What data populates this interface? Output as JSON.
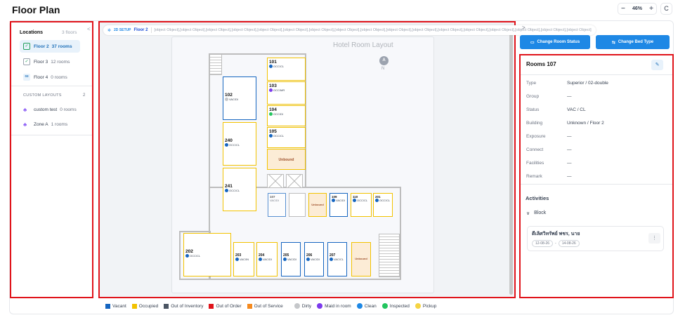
{
  "header": {
    "title": "Floor Plan",
    "zoom": "46%",
    "zoom_minus": "−",
    "zoom_plus": "+",
    "refresh": "C"
  },
  "left": {
    "locations_label": "Locations",
    "locations_count": "3 floors",
    "collapse": "<",
    "floors": [
      {
        "name": "Floor 2",
        "count": "37 rooms",
        "active": true
      },
      {
        "name": "Floor 3",
        "count": "12 rooms"
      },
      {
        "name": "Floor 4",
        "count": "0 rooms",
        "badge": "03"
      }
    ],
    "custom_label": "CUSTOM LAYOUTS",
    "custom_count": "2",
    "customs": [
      {
        "name": "custom test",
        "count": "0 rooms"
      },
      {
        "name": "Zone A",
        "count": "1 rooms"
      }
    ]
  },
  "canvas": {
    "setup": "2D SETUP",
    "floor": "Floor 2",
    "rooms": [
      {
        "no": "101",
        "st": "OCC/CL"
      },
      {
        "no": "103",
        "st": "OCC/MR"
      },
      {
        "no": "104",
        "st": "OCC/DI"
      },
      {
        "no": "105",
        "st": "OCC/CL"
      },
      {
        "no": "102",
        "st": "VAC/DI"
      },
      {
        "no": "240",
        "st": "OCC/CL"
      },
      {
        "no": "241",
        "st": "OCC/CL"
      },
      {
        "no": "107",
        "st": "VAC/DI"
      },
      {
        "no": "109",
        "st": "VAC/DI"
      },
      {
        "no": "110",
        "st": "OCC/CL"
      },
      {
        "no": "201",
        "st": "OCC/CL"
      },
      {
        "no": "202",
        "st": "OCC/CL"
      },
      {
        "no": "203",
        "st": "VAC/IN"
      },
      {
        "no": "204",
        "st": "VAC/DI"
      },
      {
        "no": "205",
        "st": "VAC/DI"
      },
      {
        "no": "206",
        "st": "VAC/DI"
      },
      {
        "no": "207",
        "st": "VAC/CL"
      }
    ],
    "layout_title": "Hotel Room Layout",
    "compass": "A",
    "north": "N",
    "unbound": "Unbound"
  },
  "legend": [
    {
      "label": "Vacant",
      "color": "#1565c0",
      "shape": "sq"
    },
    {
      "label": "Occupied",
      "color": "#f2c200",
      "shape": "sq"
    },
    {
      "label": "Out of Inventory",
      "color": "#4b5563",
      "shape": "sq"
    },
    {
      "label": "Out of Order",
      "color": "#e0141b",
      "shape": "sq"
    },
    {
      "label": "Out of Service",
      "color": "#f58a1f",
      "shape": "sq"
    },
    {
      "label": "Dirty",
      "color": "#c5c7ca",
      "shape": "cir"
    },
    {
      "label": "Maid in room",
      "color": "#7c3aed",
      "shape": "cir"
    },
    {
      "label": "Clean",
      "color": "#1e88e5",
      "shape": "cir"
    },
    {
      "label": "Inspected",
      "color": "#22c55e",
      "shape": "cir"
    },
    {
      "label": "Pickup",
      "color": "#f5d442",
      "shape": "cir"
    }
  ],
  "right": {
    "expand": ">",
    "btn_status": "Change Room Status",
    "btn_bed": "Change Bed Type",
    "room_title": "Rooms 107",
    "attrs": [
      {
        "k": "Type",
        "v": "Superior / 02-double"
      },
      {
        "k": "Group",
        "v": "—"
      },
      {
        "k": "Status",
        "v": "VAC / CL"
      },
      {
        "k": "Building",
        "v": "Unknown / Floor 2"
      },
      {
        "k": "Exposure",
        "v": "—"
      },
      {
        "k": "Connect",
        "v": "—"
      },
      {
        "k": "Facilities",
        "v": "—"
      },
      {
        "k": "Remark",
        "v": "—"
      }
    ],
    "activities": "Activities",
    "block": "Block",
    "guest": "ดีเลิศวิทรัพย์ พชร, นาย",
    "date_from": "12-08-26",
    "date_sep": "-",
    "date_to": "14-08-26",
    "more": "⋮"
  }
}
